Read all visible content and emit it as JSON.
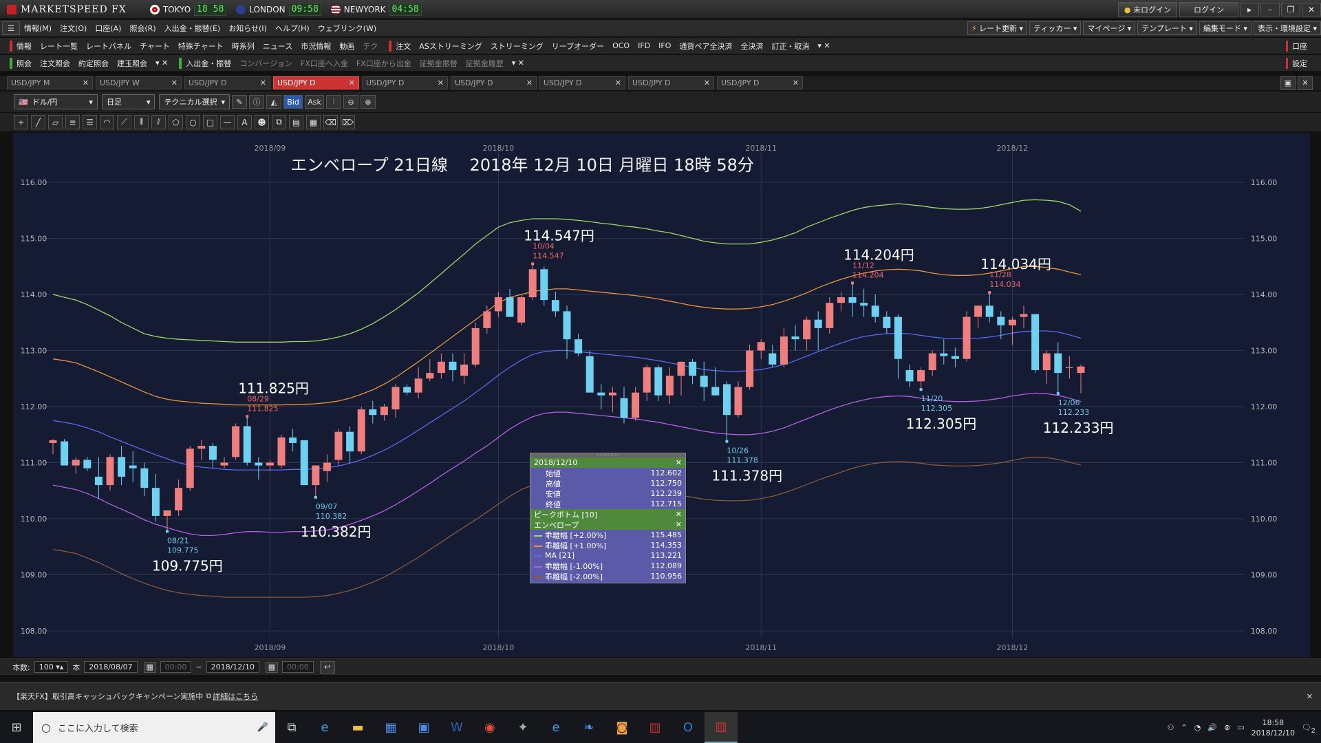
{
  "app": {
    "logo": "MARKETSPEED FX",
    "cities": [
      {
        "name": "TOKYO",
        "time": "18 58",
        "flag_color": "#ffffff"
      },
      {
        "name": "LONDON",
        "time": "09:58",
        "flag_color": "#2a3f8f"
      },
      {
        "name": "NEWYORK",
        "time": "04:58",
        "flag_color": "#b22234"
      }
    ],
    "login_status": "未ログイン",
    "login_button": "ログイン"
  },
  "menu": [
    "情報(M)",
    "注文(O)",
    "口座(A)",
    "照会(R)",
    "入出金・振替(E)",
    "お知らせ(I)",
    "ヘルプ(H)",
    "ウェブリンク(W)"
  ],
  "menu_right": [
    "レート更新",
    "ティッカー",
    "マイページ",
    "テンプレート",
    "編集モード",
    "表示・環境設定"
  ],
  "toolbar1": [
    "情報",
    "レート一覧",
    "レートパネル",
    "チャート",
    "特殊チャート",
    "時系列",
    "ニュース",
    "市況情報",
    "動画",
    "テク",
    "注文",
    "ASストリーミング",
    "ストリーミング",
    "リーブオーダー",
    "OCO",
    "IFD",
    "IFO",
    "通貨ペア全決済",
    "全決済",
    "訂正・取消"
  ],
  "toolbar1_right": "口座",
  "toolbar2": [
    "照会",
    "注文照会",
    "約定照会",
    "建玉照会",
    "入出金・振替",
    "コンバージョン",
    "FX口座へ入金",
    "FX口座から出金",
    "証拠金振替",
    "証拠金履歴"
  ],
  "toolbar2_right": "設定",
  "tabs": [
    "USD/JPY M",
    "USD/JPY W",
    "USD/JPY D",
    "USD/JPY D",
    "USD/JPY D",
    "USD/JPY D",
    "USD/JPY D",
    "USD/JPY D",
    "USD/JPY D"
  ],
  "active_tab": 3,
  "chart_controls": {
    "pair": "ドル/円",
    "period": "日足",
    "tech": "テクニカル選択",
    "bid": "Bid",
    "ask": "Ask"
  },
  "footer": {
    "count_label": "本数:",
    "count": "100",
    "unit": "本",
    "from": "2018/08/07",
    "from_time": "00:00",
    "tilde": "~",
    "to": "2018/12/10",
    "to_time": "00:00"
  },
  "news": "【楽天FX】取引高キャッシュバックキャンペーン実施中",
  "news_link": "詳細はこちら",
  "taskbar": {
    "search_placeholder": "ここに入力して検索",
    "time": "18:58",
    "date": "2018/12/10",
    "notif_count": "2"
  },
  "popup": {
    "date": "2018/12/10",
    "ohlc": [
      {
        "label": "始値",
        "value": "112.602"
      },
      {
        "label": "高値",
        "value": "112.750"
      },
      {
        "label": "安値",
        "value": "112.239"
      },
      {
        "label": "終値",
        "value": "112.715"
      }
    ],
    "peak_header": "ピークボトム [10]",
    "env_header": "エンベロープ",
    "env_rows": [
      {
        "label": "乖離幅 [+2.00%]",
        "value": "115.485",
        "color": "#9cd86a"
      },
      {
        "label": "乖離幅 [+1.00%]",
        "value": "114.353",
        "color": "#e8953a"
      },
      {
        "label": "MA [21]",
        "value": "113.221",
        "color": "#5a6ae8"
      },
      {
        "label": "乖離幅 [-1.00%]",
        "value": "112.089",
        "color": "#b060e0"
      },
      {
        "label": "乖離幅 [-2.00%]",
        "value": "110.956",
        "color": "#8a5a3a"
      }
    ]
  },
  "colors": {
    "up": "#ef7f7f",
    "down": "#6fd0f0",
    "background": "#141b33"
  },
  "chart_data": {
    "type": "candlestick",
    "title": "エンベロープ 21日線　 2018年 12月 10日 月曜日 18時 58分",
    "ylim": [
      108.0,
      116.0
    ],
    "yticks": [
      "116.00",
      "115.00",
      "114.00",
      "113.00",
      "112.00",
      "111.00",
      "110.00",
      "109.00",
      "108.00"
    ],
    "month_labels": [
      {
        "label": "2018/09",
        "index": 19
      },
      {
        "label": "2018/10",
        "index": 39
      },
      {
        "label": "2018/11",
        "index": 62
      },
      {
        "label": "2018/12",
        "index": 84
      }
    ],
    "candles": [
      [
        111.35,
        111.42,
        111.15,
        111.4
      ],
      [
        111.38,
        111.42,
        110.95,
        110.95
      ],
      [
        110.95,
        111.1,
        110.8,
        111.05
      ],
      [
        111.05,
        111.1,
        110.85,
        110.9
      ],
      [
        110.75,
        111.1,
        110.35,
        110.6
      ],
      [
        110.6,
        111.15,
        110.5,
        111.1
      ],
      [
        111.1,
        111.3,
        110.6,
        110.75
      ],
      [
        110.95,
        111.2,
        110.65,
        110.9
      ],
      [
        110.9,
        111.0,
        110.4,
        110.55
      ],
      [
        110.55,
        110.8,
        109.95,
        110.05
      ],
      [
        110.05,
        110.15,
        109.775,
        110.15
      ],
      [
        110.15,
        110.7,
        110.05,
        110.55
      ],
      [
        110.55,
        111.3,
        110.5,
        111.25
      ],
      [
        111.25,
        111.4,
        111.05,
        111.3
      ],
      [
        111.3,
        111.35,
        110.9,
        111.05
      ],
      [
        110.95,
        111.1,
        110.9,
        111.0
      ],
      [
        111.1,
        111.7,
        111.05,
        111.65
      ],
      [
        111.65,
        111.825,
        110.95,
        111.0
      ],
      [
        111.0,
        111.1,
        110.7,
        110.95
      ],
      [
        110.95,
        111.05,
        110.85,
        111.0
      ],
      [
        110.95,
        111.5,
        110.9,
        111.45
      ],
      [
        111.45,
        111.6,
        111.2,
        111.35
      ],
      [
        111.4,
        111.4,
        110.6,
        110.6
      ],
      [
        110.6,
        110.95,
        110.382,
        110.95
      ],
      [
        110.85,
        111.15,
        110.65,
        111.0
      ],
      [
        111.05,
        111.6,
        110.95,
        111.55
      ],
      [
        111.55,
        111.65,
        111.0,
        111.2
      ],
      [
        111.2,
        112.0,
        111.15,
        111.95
      ],
      [
        111.95,
        112.1,
        111.7,
        111.85
      ],
      [
        111.85,
        112.05,
        111.75,
        112.0
      ],
      [
        111.95,
        112.4,
        111.8,
        112.35
      ],
      [
        112.35,
        112.4,
        112.2,
        112.25
      ],
      [
        112.25,
        112.7,
        112.15,
        112.5
      ],
      [
        112.5,
        112.85,
        112.45,
        112.6
      ],
      [
        112.6,
        112.95,
        112.5,
        112.8
      ],
      [
        112.8,
        112.95,
        112.45,
        112.65
      ],
      [
        112.55,
        112.95,
        112.4,
        112.75
      ],
      [
        112.75,
        113.5,
        112.7,
        113.4
      ],
      [
        113.4,
        113.8,
        113.3,
        113.7
      ],
      [
        113.7,
        114.05,
        113.6,
        113.95
      ],
      [
        113.95,
        114.1,
        113.6,
        113.6
      ],
      [
        113.5,
        114.0,
        113.45,
        113.95
      ],
      [
        113.95,
        114.547,
        113.9,
        114.45
      ],
      [
        114.45,
        114.5,
        113.8,
        113.9
      ],
      [
        113.9,
        114.05,
        113.6,
        113.7
      ],
      [
        113.7,
        113.8,
        112.85,
        113.2
      ],
      [
        113.2,
        113.3,
        112.9,
        112.95
      ],
      [
        112.9,
        113.0,
        112.25,
        112.25
      ],
      [
        112.25,
        112.4,
        111.95,
        112.2
      ],
      [
        112.2,
        112.35,
        111.9,
        112.25
      ],
      [
        112.15,
        112.35,
        111.7,
        111.8
      ],
      [
        111.8,
        112.35,
        111.75,
        112.25
      ],
      [
        112.25,
        112.75,
        112.1,
        112.7
      ],
      [
        112.7,
        112.75,
        112.1,
        112.2
      ],
      [
        112.2,
        112.7,
        112.05,
        112.55
      ],
      [
        112.55,
        112.7,
        112.2,
        112.8
      ],
      [
        112.8,
        112.85,
        112.4,
        112.55
      ],
      [
        112.55,
        112.8,
        112.1,
        112.35
      ],
      [
        112.35,
        112.7,
        112.2,
        112.2
      ],
      [
        112.4,
        112.45,
        111.378,
        111.85
      ],
      [
        111.85,
        112.45,
        111.8,
        112.35
      ],
      [
        112.35,
        113.1,
        112.3,
        113.0
      ],
      [
        113.0,
        113.2,
        112.85,
        113.15
      ],
      [
        112.95,
        113.1,
        112.7,
        112.75
      ],
      [
        112.75,
        113.4,
        112.7,
        113.25
      ],
      [
        113.25,
        113.45,
        113.0,
        113.2
      ],
      [
        113.2,
        113.6,
        113.0,
        113.55
      ],
      [
        113.55,
        113.7,
        113.0,
        113.4
      ],
      [
        113.4,
        113.95,
        113.3,
        113.85
      ],
      [
        113.85,
        114.05,
        113.7,
        113.95
      ],
      [
        113.95,
        114.204,
        113.6,
        113.85
      ],
      [
        113.85,
        114.1,
        113.6,
        113.8
      ],
      [
        113.8,
        114.0,
        113.5,
        113.6
      ],
      [
        113.6,
        113.7,
        113.3,
        113.4
      ],
      [
        113.6,
        113.65,
        112.5,
        112.85
      ],
      [
        112.65,
        112.75,
        112.35,
        112.45
      ],
      [
        112.45,
        112.7,
        112.305,
        112.65
      ],
      [
        112.65,
        113.0,
        112.55,
        112.95
      ],
      [
        112.95,
        113.2,
        112.75,
        112.9
      ],
      [
        112.9,
        113.05,
        112.7,
        112.85
      ],
      [
        112.85,
        113.7,
        112.8,
        113.6
      ],
      [
        113.6,
        113.8,
        113.4,
        113.8
      ],
      [
        113.8,
        114.034,
        113.5,
        113.6
      ],
      [
        113.6,
        113.7,
        113.2,
        113.45
      ],
      [
        113.45,
        113.6,
        113.1,
        113.55
      ],
      [
        113.6,
        113.8,
        113.4,
        113.65
      ],
      [
        113.65,
        113.65,
        112.6,
        112.65
      ],
      [
        112.65,
        113.0,
        112.4,
        112.95
      ],
      [
        112.95,
        113.15,
        112.233,
        112.6
      ],
      [
        112.7,
        112.9,
        112.5,
        112.7
      ],
      [
        112.602,
        112.75,
        112.239,
        112.715
      ]
    ],
    "ma": [
      111.75,
      111.72,
      111.68,
      111.62,
      111.55,
      111.46,
      111.38,
      111.3,
      111.22,
      111.14,
      111.07,
      111.0,
      110.95,
      110.92,
      110.9,
      110.88,
      110.87,
      110.87,
      110.87,
      110.87,
      110.87,
      110.88,
      110.88,
      110.89,
      110.91,
      110.94,
      110.99,
      111.05,
      111.13,
      111.22,
      111.33,
      111.45,
      111.58,
      111.71,
      111.84,
      111.97,
      112.1,
      112.25,
      112.4,
      112.56,
      112.7,
      112.83,
      112.93,
      112.98,
      113.0,
      113.0,
      112.98,
      112.96,
      112.94,
      112.92,
      112.9,
      112.88,
      112.85,
      112.82,
      112.78,
      112.74,
      112.7,
      112.66,
      112.64,
      112.63,
      112.63,
      112.64,
      112.66,
      112.7,
      112.75,
      112.82,
      112.9,
      112.98,
      113.06,
      113.13,
      113.2,
      113.25,
      113.28,
      113.3,
      113.31,
      113.3,
      113.27,
      113.24,
      113.22,
      113.21,
      113.21,
      113.22,
      113.24,
      113.27,
      113.31,
      113.34,
      113.35,
      113.35,
      113.33,
      113.28,
      113.221
    ],
    "upper2": [
      114.0,
      113.95,
      113.9,
      113.82,
      113.72,
      113.62,
      113.5,
      113.4,
      113.3,
      113.25,
      113.22,
      113.2,
      113.19,
      113.18,
      113.17,
      113.16,
      113.15,
      113.15,
      113.15,
      113.15,
      113.15,
      113.16,
      113.16,
      113.17,
      113.2,
      113.24,
      113.3,
      113.38,
      113.48,
      113.6,
      113.73,
      113.88,
      114.03,
      114.2,
      114.37,
      114.55,
      114.72,
      114.9,
      115.05,
      115.2,
      115.28,
      115.32,
      115.35,
      115.35,
      115.35,
      115.34,
      115.32,
      115.3,
      115.27,
      115.25,
      115.22,
      115.2,
      115.17,
      115.13,
      115.1,
      115.05,
      115.0,
      114.95,
      114.92,
      114.9,
      114.9,
      114.9,
      114.93,
      114.97,
      115.03,
      115.1,
      115.2,
      115.28,
      115.36,
      115.43,
      115.5,
      115.55,
      115.58,
      115.6,
      115.62,
      115.6,
      115.58,
      115.55,
      115.53,
      115.52,
      115.52,
      115.53,
      115.56,
      115.6,
      115.64,
      115.68,
      115.69,
      115.68,
      115.66,
      115.6,
      115.485
    ],
    "upper1": [
      112.85,
      112.82,
      112.78,
      112.7,
      112.62,
      112.53,
      112.44,
      112.35,
      112.26,
      112.18,
      112.13,
      112.1,
      112.08,
      112.06,
      112.05,
      112.04,
      112.03,
      112.03,
      112.03,
      112.03,
      112.03,
      112.04,
      112.04,
      112.05,
      112.07,
      112.1,
      112.15,
      112.22,
      112.3,
      112.4,
      112.52,
      112.66,
      112.8,
      112.95,
      113.1,
      113.25,
      113.4,
      113.55,
      113.7,
      113.85,
      113.95,
      114.0,
      114.05,
      114.08,
      114.1,
      114.1,
      114.08,
      114.06,
      114.04,
      114.02,
      114.0,
      113.98,
      113.95,
      113.92,
      113.88,
      113.84,
      113.8,
      113.77,
      113.75,
      113.74,
      113.74,
      113.75,
      113.78,
      113.82,
      113.88,
      113.95,
      114.03,
      114.12,
      114.2,
      114.27,
      114.33,
      114.38,
      114.42,
      114.44,
      114.45,
      114.44,
      114.42,
      114.38,
      114.35,
      114.34,
      114.34,
      114.35,
      114.38,
      114.42,
      114.46,
      114.5,
      114.5,
      114.48,
      114.45,
      114.4,
      114.353
    ],
    "lower1": [
      110.6,
      110.56,
      110.52,
      110.45,
      110.36,
      110.26,
      110.17,
      110.08,
      109.98,
      109.9,
      109.84,
      109.78,
      109.73,
      109.7,
      109.7,
      109.72,
      109.75,
      109.77,
      109.77,
      109.76,
      109.76,
      109.77,
      109.77,
      109.78,
      109.8,
      109.84,
      109.9,
      109.97,
      110.05,
      110.14,
      110.25,
      110.37,
      110.5,
      110.63,
      110.77,
      110.9,
      111.03,
      111.17,
      111.3,
      111.45,
      111.6,
      111.72,
      111.82,
      111.88,
      111.9,
      111.9,
      111.88,
      111.86,
      111.84,
      111.82,
      111.8,
      111.78,
      111.75,
      111.72,
      111.68,
      111.64,
      111.6,
      111.56,
      111.53,
      111.51,
      111.5,
      111.5,
      111.52,
      111.56,
      111.62,
      111.7,
      111.78,
      111.86,
      111.94,
      112.01,
      112.07,
      112.12,
      112.16,
      112.18,
      112.19,
      112.18,
      112.15,
      112.12,
      112.1,
      112.09,
      112.09,
      112.1,
      112.12,
      112.15,
      112.19,
      112.22,
      112.24,
      112.23,
      112.2,
      112.15,
      112.089
    ],
    "lower2": [
      109.45,
      109.42,
      109.38,
      109.3,
      109.22,
      109.12,
      109.02,
      108.93,
      108.85,
      108.78,
      108.72,
      108.68,
      108.65,
      108.63,
      108.62,
      108.6,
      108.6,
      108.6,
      108.6,
      108.6,
      108.6,
      108.6,
      108.6,
      108.61,
      108.63,
      108.67,
      108.72,
      108.79,
      108.87,
      108.96,
      109.07,
      109.19,
      109.31,
      109.45,
      109.58,
      109.72,
      109.85,
      109.98,
      110.12,
      110.26,
      110.4,
      110.52,
      110.6,
      110.65,
      110.68,
      110.68,
      110.67,
      110.65,
      110.62,
      110.6,
      110.58,
      110.55,
      110.52,
      110.49,
      110.46,
      110.42,
      110.38,
      110.35,
      110.33,
      110.32,
      110.32,
      110.33,
      110.36,
      110.4,
      110.46,
      110.53,
      110.61,
      110.69,
      110.76,
      110.83,
      110.9,
      110.95,
      110.99,
      111.01,
      111.02,
      111.01,
      110.99,
      110.96,
      110.95,
      110.94,
      110.94,
      110.95,
      110.97,
      111.0,
      111.04,
      111.08,
      111.1,
      111.09,
      111.06,
      111.01,
      110.956
    ],
    "peaks": [
      {
        "index": 10,
        "type": "bottom",
        "date": "08/21",
        "price": "109.775",
        "big": "109.775円"
      },
      {
        "index": 17,
        "type": "top",
        "date": "08/29",
        "price": "111.825",
        "big": "111.825円"
      },
      {
        "index": 23,
        "type": "bottom",
        "date": "09/07",
        "price": "110.382",
        "big": "110.382円"
      },
      {
        "index": 42,
        "type": "top",
        "date": "10/04",
        "price": "114.547",
        "big": "114.547円"
      },
      {
        "index": 59,
        "type": "bottom",
        "date": "10/26",
        "price": "111.378",
        "big": "111.378円"
      },
      {
        "index": 70,
        "type": "top",
        "date": "11/12",
        "price": "114.204",
        "big": "114.204円"
      },
      {
        "index": 76,
        "type": "bottom",
        "date": "11/20",
        "price": "112.305",
        "big": "112.305円"
      },
      {
        "index": 82,
        "type": "top",
        "date": "11/28",
        "price": "114.034",
        "big": "114.034円"
      },
      {
        "index": 88,
        "type": "bottom",
        "date": "12/06",
        "price": "112.233",
        "big": "112.233円"
      }
    ]
  }
}
